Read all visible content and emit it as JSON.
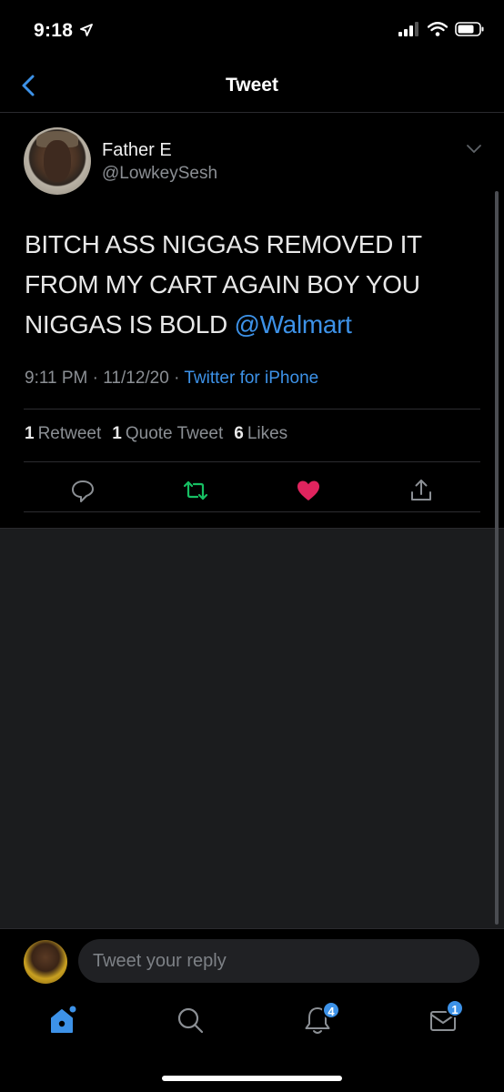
{
  "status_bar": {
    "time": "9:18"
  },
  "nav": {
    "title": "Tweet"
  },
  "tweet": {
    "display_name": "Father E",
    "handle": "@LowkeySesh",
    "text": "BITCH ASS NIGGAS REMOVED IT FROM MY CART AGAIN BOY YOU NIGGAS IS BOLD ",
    "mention": "@Walmart",
    "time": "9:11 PM",
    "date": "11/12/20",
    "separator": "·",
    "source": "Twitter for iPhone",
    "stats": {
      "retweets_count": "1",
      "retweets_label": "Retweet",
      "quotes_count": "1",
      "quotes_label": "Quote Tweet",
      "likes_count": "6",
      "likes_label": "Likes"
    },
    "liked": true
  },
  "reply": {
    "placeholder": "Tweet your reply"
  },
  "tabs": {
    "notifications_badge": "4",
    "messages_badge": "1"
  },
  "colors": {
    "accent": "#3d92e8",
    "like": "#e0245e",
    "retweet": "#17bf63",
    "background": "#000000"
  },
  "icons": [
    "location-arrow-icon",
    "signal-icon",
    "wifi-icon",
    "battery-icon",
    "back-chevron-icon",
    "caret-down-icon",
    "reply-icon",
    "retweet-icon",
    "heart-icon",
    "share-icon",
    "home-icon",
    "search-icon",
    "bell-icon",
    "mail-icon"
  ]
}
